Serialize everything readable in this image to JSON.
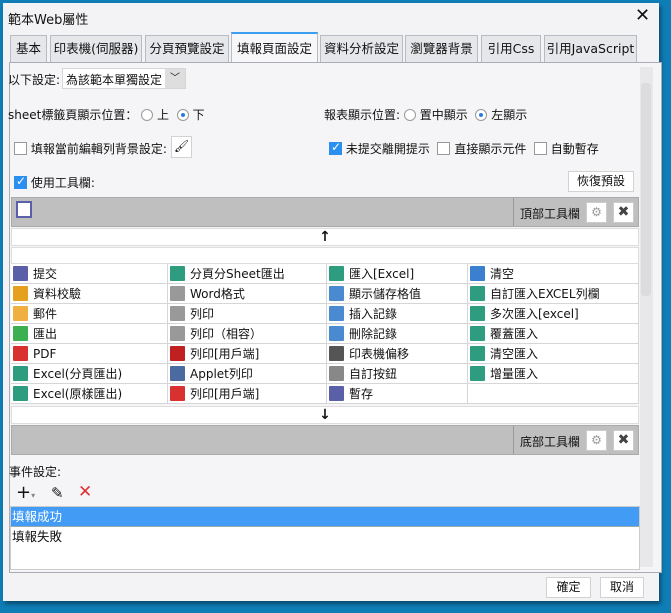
{
  "window": {
    "title": "範本Web屬性",
    "close": "✕"
  },
  "tabs": [
    {
      "label": "基本"
    },
    {
      "label": "印表機(伺服器)"
    },
    {
      "label": "分頁預覽設定"
    },
    {
      "label": "填報頁面設定"
    },
    {
      "label": "資料分析設定"
    },
    {
      "label": "瀏覽器背景"
    },
    {
      "label": "引用Css"
    },
    {
      "label": "引用JavaScript"
    }
  ],
  "settings": {
    "scope_label": "以下設定:",
    "scope_value": "為該範本單獨設定",
    "sheet_label": "sheet標籤頁顯示位置：",
    "sheet_top": "上",
    "sheet_bottom": "下",
    "report_label": "報表顯示位置:",
    "report_center": "置中顯示",
    "report_left": "左顯示",
    "row_bg_label": "填報當前編輯列背景設定:",
    "leave_prompt": "未提交離開提示",
    "direct_show": "直接顯示元件",
    "auto_save": "自動暫存",
    "use_toolbar": "使用工具欄:",
    "restore_default": "恢復預設"
  },
  "toolbar": {
    "top_label": "頂部工具欄",
    "bottom_label": "底部工具欄",
    "up": "↑",
    "down": "↓"
  },
  "buttons": [
    {
      "label": "提交",
      "icon": "save-icon",
      "color": "#5a5fa8"
    },
    {
      "label": "分頁分Sheet匯出",
      "icon": "excel-icon",
      "color": "#2e9c7e"
    },
    {
      "label": "匯入[Excel]",
      "icon": "excel-icon",
      "color": "#2e9c7e"
    },
    {
      "label": "清空",
      "icon": "eraser-icon",
      "color": "#3a7fd0"
    },
    {
      "label": "資料校驗",
      "icon": "pencil-icon",
      "color": "#e6a020"
    },
    {
      "label": "Word格式",
      "icon": "word-icon",
      "color": "#999999"
    },
    {
      "label": "顯示儲存格值",
      "icon": "cell-icon",
      "color": "#4a8ad0"
    },
    {
      "label": "自訂匯入EXCEL列欄",
      "icon": "excel-icon",
      "color": "#2e9c7e"
    },
    {
      "label": "郵件",
      "icon": "mail-icon",
      "color": "#f0b040"
    },
    {
      "label": "列印",
      "icon": "printer-icon",
      "color": "#999999"
    },
    {
      "label": "插入記錄",
      "icon": "insert-row-icon",
      "color": "#4a8ad0"
    },
    {
      "label": "多次匯入[excel]",
      "icon": "excel-icon",
      "color": "#2e9c7e"
    },
    {
      "label": "匯出",
      "icon": "export-icon",
      "color": "#3cb050"
    },
    {
      "label": "列印（相容）",
      "icon": "printer-icon",
      "color": "#999999"
    },
    {
      "label": "刪除記錄",
      "icon": "delete-row-icon",
      "color": "#4a8ad0"
    },
    {
      "label": "覆蓋匯入",
      "icon": "excel-icon",
      "color": "#2e9c7e"
    },
    {
      "label": "PDF",
      "icon": "pdf-icon",
      "color": "#d93030"
    },
    {
      "label": "列印[用戶端]",
      "icon": "flash-print-icon",
      "color": "#c02020"
    },
    {
      "label": "印表機偏移",
      "icon": "move-icon",
      "color": "#555555"
    },
    {
      "label": "清空匯入",
      "icon": "excel-icon",
      "color": "#2e9c7e"
    },
    {
      "label": "Excel(分頁匯出)",
      "icon": "excel-icon",
      "color": "#2e9c7e"
    },
    {
      "label": "Applet列印",
      "icon": "java-icon",
      "color": "#4a6aa0"
    },
    {
      "label": "自訂按鈕",
      "icon": "gear-icon",
      "color": "#888888"
    },
    {
      "label": "增量匯入",
      "icon": "excel-icon",
      "color": "#2e9c7e"
    },
    {
      "label": "Excel(原樣匯出)",
      "icon": "excel-icon",
      "color": "#2e9c7e"
    },
    {
      "label": "列印[用戶端]",
      "icon": "pdf-print-icon",
      "color": "#d93030"
    },
    {
      "label": "暫存",
      "icon": "save-clock-icon",
      "color": "#5a5fa8"
    },
    {
      "label": "",
      "icon": "",
      "color": ""
    }
  ],
  "events": {
    "label": "事件設定:",
    "items": [
      {
        "label": "填報成功",
        "selected": true
      },
      {
        "label": "填報失敗",
        "selected": false
      }
    ]
  },
  "footer": {
    "ok": "確定",
    "cancel": "取消"
  }
}
